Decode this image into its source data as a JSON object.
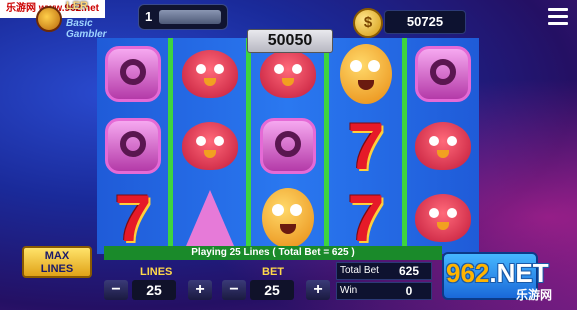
{
  "watermark": {
    "text": "乐游网 www.962.net"
  },
  "player": {
    "name": "LER",
    "rank": "Basic Gambler"
  },
  "level": {
    "number": "1"
  },
  "balance": {
    "coin_icon": "$",
    "value": "50725"
  },
  "win_display": {
    "value": "50050"
  },
  "status": {
    "message": "Playing 25 Lines ( Total Bet = 625 )"
  },
  "controls": {
    "max_lines_line1": "MAX",
    "max_lines_line2": "LINES",
    "lines_label": "LINES",
    "lines_value": "25",
    "bet_label": "BET",
    "bet_value": "25",
    "minus": "−",
    "plus": "+"
  },
  "info": {
    "total_bet_label": "Total Bet",
    "total_bet_value": "625",
    "win_label": "Win",
    "win_value": "0"
  },
  "logo": {
    "big_text_a": "962",
    "big_text_b": ".NET",
    "small_text": "乐游网"
  },
  "reels": [
    [
      "q-symbol",
      "q-symbol",
      "seven-symbol"
    ],
    [
      "bird-symbol",
      "bird-symbol",
      "a-symbol"
    ],
    [
      "bird-symbol",
      "q-symbol",
      "egg-symbol"
    ],
    [
      "egg-symbol",
      "seven-symbol",
      "seven-symbol"
    ],
    [
      "q-symbol",
      "bird-symbol",
      "bird-symbol"
    ]
  ]
}
